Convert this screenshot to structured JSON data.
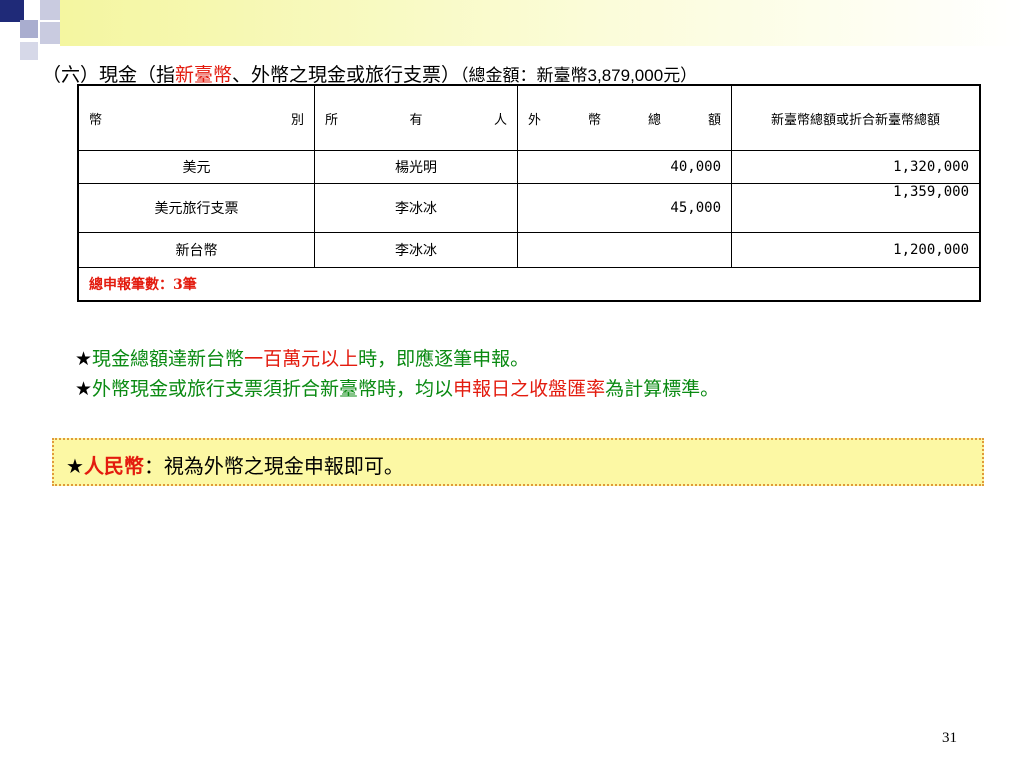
{
  "heading": {
    "prefix": "（六）現金（指",
    "highlight": "新臺幣",
    "suffix": "、外幣之現金或旅行支票）",
    "total_prefix": "（總金額：新臺幣",
    "total_amount": "3,879,000",
    "total_suffix": "元）"
  },
  "table": {
    "headers": {
      "currency": [
        "幣",
        "別"
      ],
      "owner": [
        "所",
        "有",
        "人"
      ],
      "foreign_total": [
        "外",
        "幣",
        "總",
        "額"
      ],
      "twd_total": "新臺幣總額或折合新臺幣總額"
    },
    "rows": [
      {
        "currency": "美元",
        "owner": "楊光明",
        "foreign_total": "40,000",
        "twd_total": "1,320,000"
      },
      {
        "currency": "美元旅行支票",
        "owner": "李冰冰",
        "foreign_total": "45,000",
        "twd_total": "1,359,000"
      },
      {
        "currency": "新台幣",
        "owner": "李冰冰",
        "foreign_total": "",
        "twd_total": "1,200,000"
      }
    ],
    "summary": "總申報筆數：3筆"
  },
  "notes": {
    "line1": {
      "star": "★",
      "part1": "現金總額達新台幣",
      "red": "一百萬元以上",
      "part2": "時，即應逐筆申報。"
    },
    "line2": {
      "star": "★",
      "part1": "外幣現金或旅行支票須折合新臺幣時，均以",
      "red": "申報日之收盤匯率",
      "part2": "為計算標準。"
    }
  },
  "callout": {
    "star": "★",
    "red": "人民幣",
    "text": "：視為外幣之現金申報即可。"
  },
  "page_number": "31",
  "colors": {
    "accent_red": "#e31b0e",
    "note_green": "#0a8a12",
    "callout_bg": "#fcf8a4",
    "callout_border": "#e09a3a",
    "header_square": "#1f2a78"
  }
}
